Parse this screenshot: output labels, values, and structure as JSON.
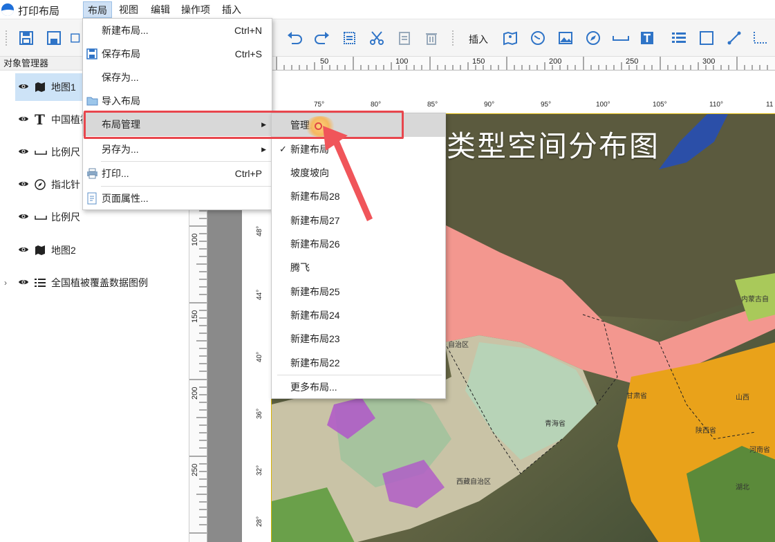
{
  "app": {
    "title": "打印布局"
  },
  "menubar": [
    "布局",
    "视图",
    "编辑",
    "操作项",
    "插入"
  ],
  "toolbar": {
    "insert_label": "插入"
  },
  "panel": {
    "header": "对象管理器",
    "items": [
      {
        "label": "地图1",
        "icon": "map-icon"
      },
      {
        "label": "中国植被",
        "icon": "text-icon"
      },
      {
        "label": "比例尺",
        "icon": "scale-bar-icon"
      },
      {
        "label": "指北针",
        "icon": "north-arrow-icon"
      },
      {
        "label": "比例尺",
        "icon": "scale-bar-icon"
      },
      {
        "label": "地图2",
        "icon": "map-icon"
      },
      {
        "label": "全国植被覆盖数据图例",
        "icon": "legend-icon"
      }
    ]
  },
  "ruler_h": [
    "50",
    "100",
    "150",
    "200",
    "250",
    "300"
  ],
  "ruler_v": [
    "100",
    "150",
    "200",
    "250"
  ],
  "map": {
    "title": "类型空间分布图",
    "lon_ticks": [
      "75°",
      "80°",
      "85°",
      "90°",
      "95°",
      "100°",
      "105°",
      "110°",
      "11"
    ],
    "lat_ticks": [
      "48°",
      "44°",
      "40°",
      "36°",
      "32°",
      "28°"
    ],
    "regions": [
      "内蒙古自",
      "自治区",
      "甘肃省",
      "青海省",
      "山西",
      "陕西省",
      "河南省",
      "西藏自治区",
      "湖北"
    ]
  },
  "layout_menu": {
    "items": [
      {
        "label": "新建布局...",
        "shortcut": "Ctrl+N"
      },
      {
        "label": "保存布局",
        "shortcut": "Ctrl+S"
      },
      {
        "label": "保存为...",
        "shortcut": ""
      },
      {
        "label": "导入布局",
        "shortcut": ""
      },
      {
        "label": "布局管理",
        "shortcut": ""
      },
      {
        "label": "另存为...",
        "shortcut": ""
      },
      {
        "label": "打印...",
        "shortcut": "Ctrl+P"
      },
      {
        "label": "页面属性...",
        "shortcut": ""
      }
    ]
  },
  "submenu": {
    "items": [
      "管理...",
      "新建布局",
      "坡度坡向",
      "新建布局28",
      "新建布局27",
      "新建布局26",
      "腾飞",
      "新建布局25",
      "新建布局24",
      "新建布局23",
      "新建布局22"
    ],
    "more": "更多布局..."
  },
  "colors": {
    "accent": "#1e6fd9",
    "highlight": "#e8464d"
  }
}
